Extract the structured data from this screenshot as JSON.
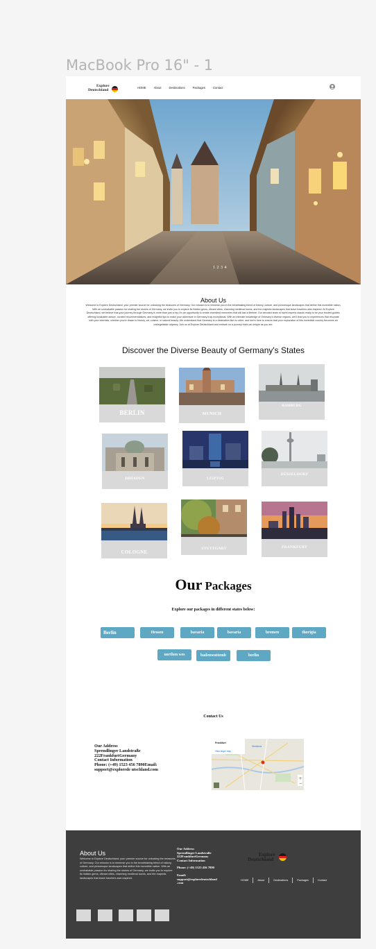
{
  "frame": {
    "title": "MacBook Pro 16\" - 1"
  },
  "brand": {
    "line1": "Explore",
    "line2": "Deutschland",
    "flag_colors": [
      "#1a1a1a",
      "#dd2020",
      "#f2c200"
    ]
  },
  "nav": {
    "items": [
      "HOME",
      "About",
      "Destinations",
      "Packages",
      "Contact"
    ],
    "user_icon": "user-icon"
  },
  "hero": {
    "caption": "1 2 3 4"
  },
  "about": {
    "title": "About Us",
    "text": "Welcome to Explore Deutschland, your premier source for unlocking the treasures of Germany. Our mission is to immerse you in the breathtaking blend of history, culture, and picturesque landscapes that define this incredible nation. With an unshakable passion for sharing the stories of Germany, we invite you to explore its hidden gems, vibrant cities, charming medieval towns, and the majestic landscapes that leave travelers awe-inspired. At Explore Deutschland, we believe that your journey through Germany is more than just a trip; it's an opportunity to create cherished memories that will last a lifetime. Our devoted team of travel experts stands ready to be your trusted guides, offering invaluable advice, curated recommendations, and insightful tips to make your adventure in Germany truly exceptional. With an intimate knowledge of Germany's diverse regions, we'll lead you to experiences that resonate with your interests, whether you're drawn to history, art, cuisine, or natural beauty. We understand that Germany is a destination like no other, and we're here to ensure that your exploration of this incredible country becomes an unforgettable odyssey. Join us at Explore Deutschland and embark on a journey that's as unique as you are."
  },
  "states": {
    "title": "Discover the Diverse Beauty of Germany's States",
    "cards": [
      "BERLIN",
      "MUNICH",
      "HAMBURG",
      "DRESDEN",
      "LEIPZIG",
      "DÜSSELDORF",
      "COLOGNE",
      "STUTTGART",
      "FRANKFURT"
    ]
  },
  "packages": {
    "title_a": "Our",
    "title_b": "Packages",
    "subtitle": "Explore our packages in different states below:",
    "row1": [
      "Berlin",
      "Hessen",
      "bavaria",
      "bavaria",
      "bremen",
      "thorigia"
    ],
    "row2": [
      "northen wes",
      "badenwuttemb",
      "berlin"
    ],
    "accent": "#5fa8c4"
  },
  "contact": {
    "title": "Contact Us",
    "lines": [
      "Our Address",
      "Sprendlinger Landstraße",
      "222FrankfurtGermany",
      "Contact Information",
      "Phone: (+49) 1523 456 7890Email:",
      "support@explorede utschland.com"
    ],
    "map": {
      "place": "Frankfurt",
      "directions": "Directions",
      "view_larger": "View larger map"
    }
  },
  "footer": {
    "about_title": "About Us",
    "about_text": "Welcome to Explore Deutschland, your premier source for unlocking the treasures of Germany. Our mission is to immerse you in the breathtaking blend of history, culture, and picturesque landscapes that define this incredible nation. With an unshakable passion for sharing the stories of Germany, we invite you to explore its hidden gems, vibrant cities, charming medieval towns, and the majestic landscapes that leave travelers awe-inspired.",
    "address": [
      "Our Address",
      "Sprendlinger Landstraße",
      "222FrankfurtGermany",
      "Contact Information"
    ],
    "phone": "Phone: (+49) 1523 456 7890",
    "email": [
      "Email:",
      "support@exploredeutschland",
      ".com"
    ],
    "nav": [
      "HOME",
      "About",
      "Destinations",
      "Packages",
      "Contact"
    ],
    "background": "#3e3e3e"
  }
}
